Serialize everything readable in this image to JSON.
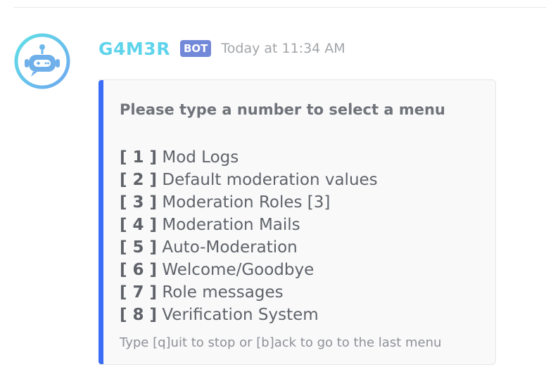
{
  "message": {
    "author": "G4M3R",
    "bot_tag": "BOT",
    "timestamp": "Today at 11:34 AM",
    "avatar_icon": "robot-gamepad-icon"
  },
  "embed": {
    "accent_color": "#3b6cf6",
    "title": "Please type a number to select a menu",
    "items": [
      {
        "key": "[ 1 ]",
        "label": "Mod Logs"
      },
      {
        "key": "[ 2 ]",
        "label": "Default moderation values"
      },
      {
        "key": "[ 3 ]",
        "label": "Moderation Roles [3]"
      },
      {
        "key": "[ 4 ]",
        "label": "Moderation Mails"
      },
      {
        "key": "[ 5 ]",
        "label": "Auto-Moderation"
      },
      {
        "key": "[ 6 ]",
        "label": "Welcome/Goodbye"
      },
      {
        "key": "[ 7 ]",
        "label": "Role messages"
      },
      {
        "key": "[ 8 ]",
        "label": "Verification System"
      }
    ],
    "footer": "Type [q]uit to stop or [b]ack to go to the last menu"
  }
}
